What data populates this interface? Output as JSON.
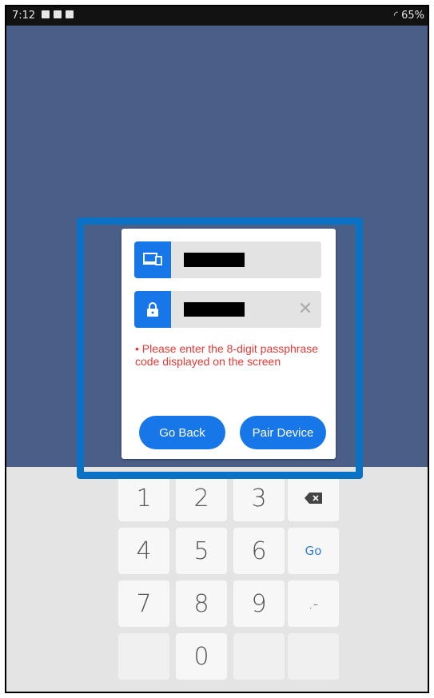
{
  "status_bar": {
    "time": "7:12",
    "battery": "65%"
  },
  "dialog": {
    "device_field": {
      "icon": "device-icon"
    },
    "passcode_field": {
      "icon": "lock-icon"
    },
    "error_message": "• Please enter the 8-digit passphrase code displayed on the screen",
    "go_back_label": "Go Back",
    "pair_device_label": "Pair Device"
  },
  "keypad": {
    "row1": [
      "1",
      "2",
      "3"
    ],
    "row2": [
      "4",
      "5",
      "6"
    ],
    "row3": [
      "7",
      "8",
      "9"
    ],
    "zero": "0",
    "go_label": "Go",
    "punct_label": ".-"
  },
  "colors": {
    "accent": "#1877e8",
    "error": "#e53935",
    "highlight": "#0a72c4",
    "background": "#4a5f87"
  }
}
